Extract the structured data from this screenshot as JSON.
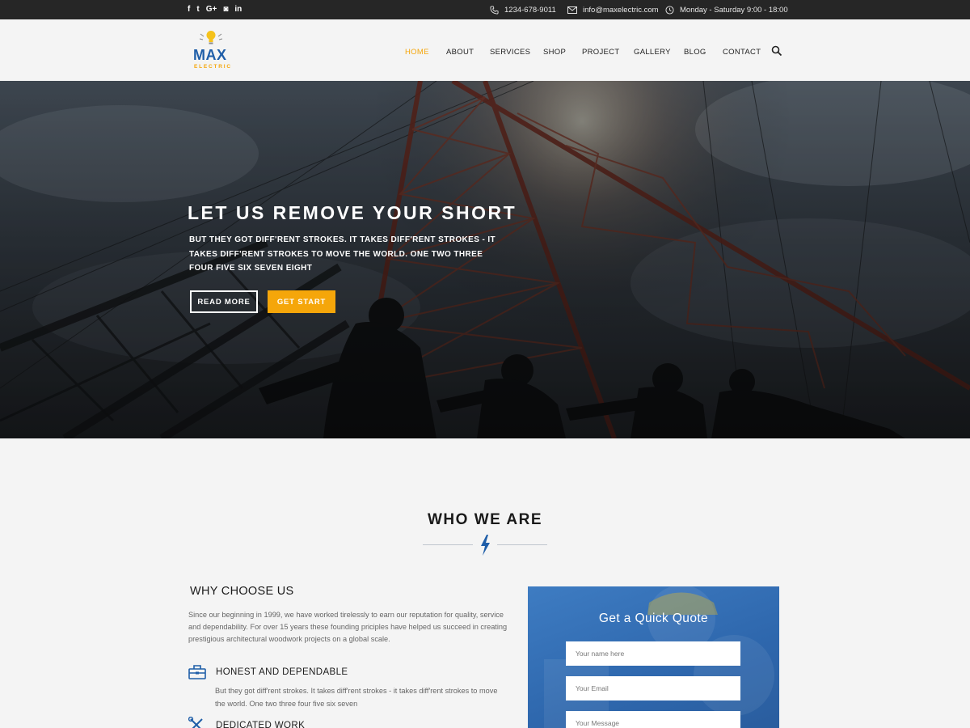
{
  "topbar": {
    "social": [
      {
        "icon": "facebook-icon",
        "glyph": "f"
      },
      {
        "icon": "twitter-icon",
        "glyph": "t"
      },
      {
        "icon": "google-plus-icon",
        "glyph": "G+"
      },
      {
        "icon": "instagram-icon",
        "glyph": "◙"
      },
      {
        "icon": "linkedin-icon",
        "glyph": "in"
      }
    ],
    "phone": "1234-678-9011",
    "email": "info@maxelectric.com",
    "hours": "Monday - Saturday 9:00 - 18:00"
  },
  "logo": {
    "title": "MAX",
    "subtitle": "ELECTRIC"
  },
  "nav": {
    "items": [
      "HOME",
      "ABOUT",
      "SERVICES",
      "SHOP",
      "PROJECT",
      "GALLERY",
      "BLOG",
      "CONTACT"
    ],
    "active": "HOME"
  },
  "hero": {
    "title": "LET US REMOVE YOUR SHORT",
    "subtitle": "BUT THEY GOT DIFF'RENT STROKES. IT TAKES DIFF'RENT STROKES - IT TAKES DIFF'RENT STROKES TO MOVE THE WORLD. ONE TWO THREE FOUR FIVE SIX SEVEN EIGHT",
    "btn_read_more": "READ MORE",
    "btn_get_start": "GET START"
  },
  "who": {
    "title": "WHO WE ARE",
    "why_title": "WHY CHOOSE US",
    "why_text": "Since our beginning in 1999, we have worked tirelessly to earn our reputation for quality, service and dependability. For over 15 years these founding priciples have helped us succeed in creating prestigious architectural woodwork projects on a global scale.",
    "features": [
      {
        "title": "HONEST AND DEPENDABLE",
        "text": "But they got diff'rent strokes. It takes diff'rent strokes - it takes diff'rent strokes to move the world. One two three four five six seven",
        "icon": "toolbox-icon"
      },
      {
        "title": "DEDICATED WORK",
        "icon": "tools-icon"
      }
    ]
  },
  "quote": {
    "title": "Get a Quick Quote",
    "name_placeholder": "Your name here",
    "email_placeholder": "Your Email",
    "message_placeholder": "Your Message"
  },
  "colors": {
    "accent": "#f5a60a",
    "brand_blue": "#1f5ea8",
    "topbar_bg": "#262626"
  }
}
